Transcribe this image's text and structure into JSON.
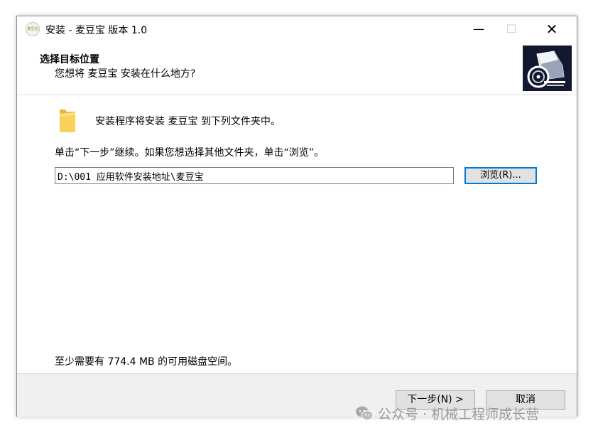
{
  "window": {
    "title": "安装 - 麦豆宝 版本 1.0",
    "app_icon_text": "麦豆宝",
    "minimize_glyph": "—",
    "maximize_glyph": "☐",
    "close_glyph": "✕"
  },
  "header": {
    "title": "选择目标位置",
    "subtitle": "您想将 麦豆宝 安装在什么地方?"
  },
  "body": {
    "info_text": "安装程序将安装 麦豆宝 到下列文件夹中。",
    "instruction": "单击“下一步”继续。如果您想选择其他文件夹，单击“浏览”。",
    "path_value": "D:\\001 应用软件安装地址\\麦豆宝",
    "browse_label": "浏览(R)...",
    "disk_space": "至少需要有 774.4 MB 的可用磁盘空间。"
  },
  "footer": {
    "next_label": "下一步(N) >",
    "cancel_label": "取消"
  },
  "watermark": {
    "text": "公众号 · 机械工程师成长营"
  },
  "colors": {
    "accent": "#0078d7",
    "header_image_bg": "#11182f",
    "folder": "#f5c542",
    "footer_bg": "#f0f0f0"
  }
}
